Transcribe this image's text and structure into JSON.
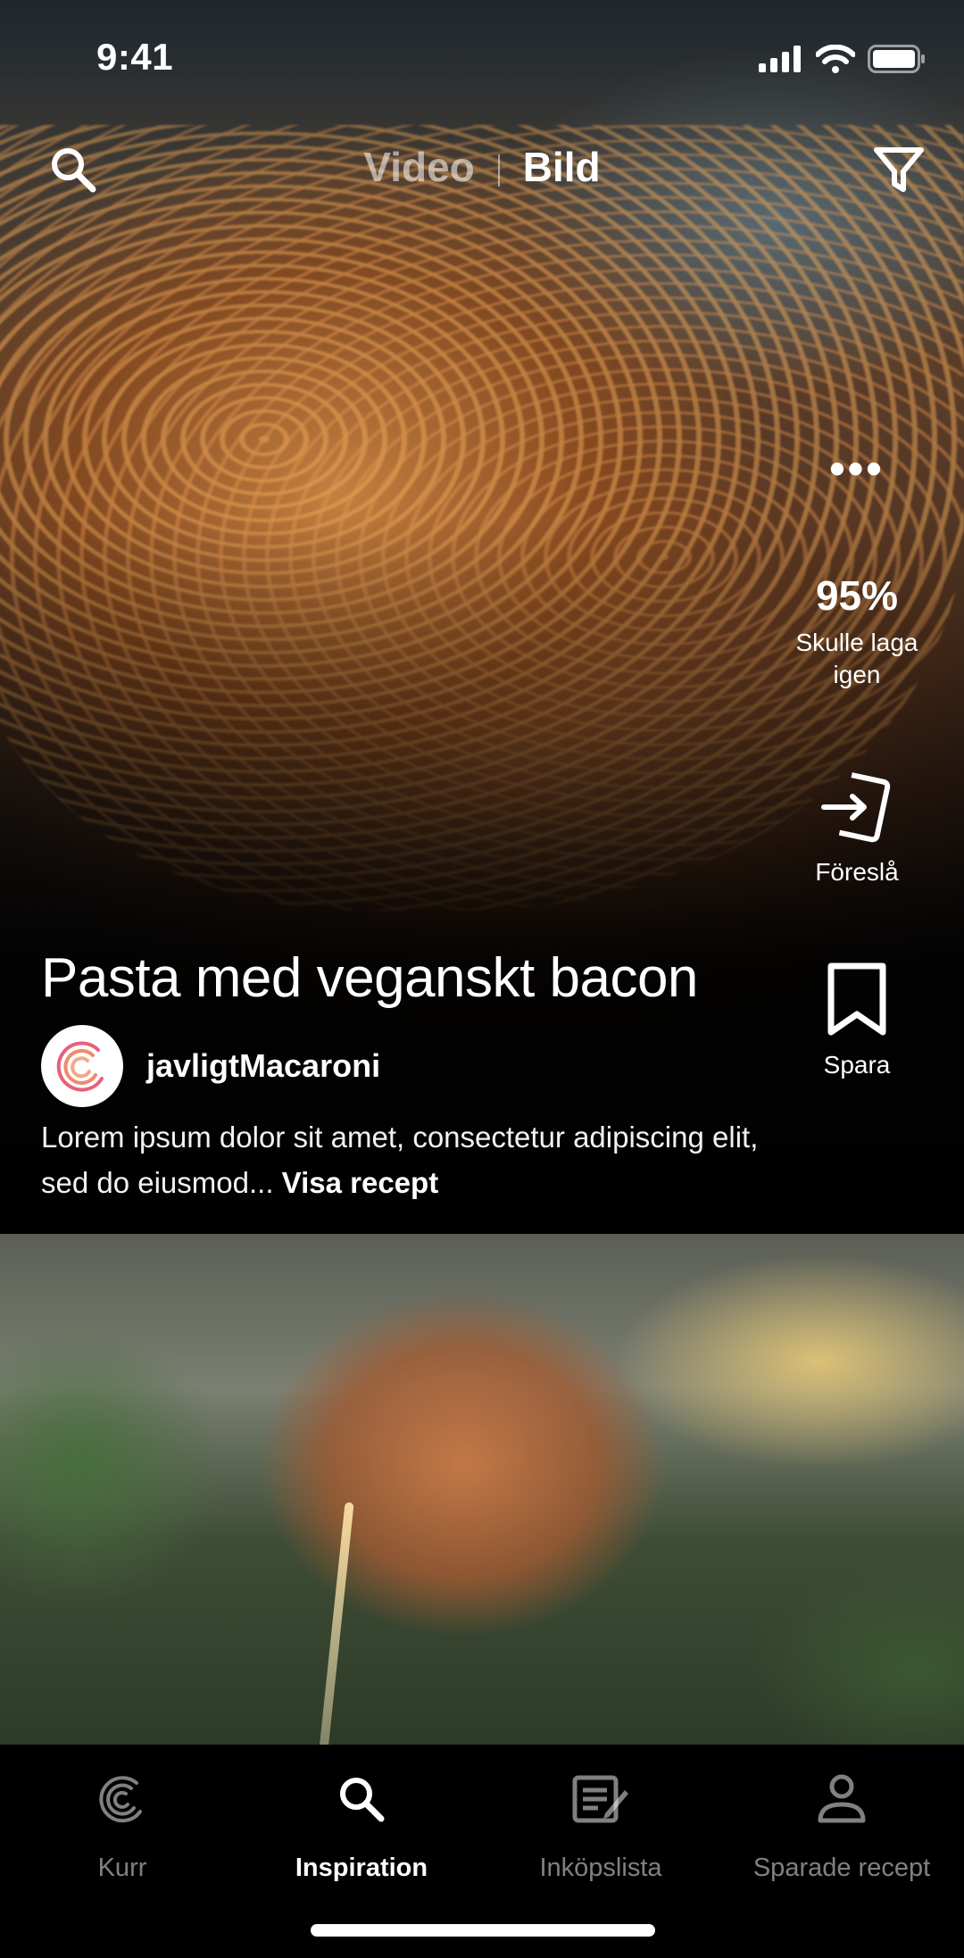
{
  "status_bar": {
    "time": "9:41"
  },
  "top_bar": {
    "mode_video": "Video",
    "mode_image": "Bild",
    "active_mode": "Bild"
  },
  "actions": {
    "more": "•••",
    "rating_value": "95%",
    "rating_label_line1": "Skulle laga",
    "rating_label_line2": "igen",
    "suggest_label": "Föreslå",
    "save_label": "Spara"
  },
  "recipe": {
    "title": "Pasta med veganskt bacon",
    "author": "javligtMacaroni",
    "description": "Lorem ipsum dolor sit amet, consectetur adipiscing elit, sed do eiusmod...",
    "show_recipe_link": "Visa recept"
  },
  "nav": {
    "items": [
      {
        "label": "Kurr",
        "icon": "kurr-logo-icon",
        "active": false
      },
      {
        "label": "Inspiration",
        "icon": "search-icon",
        "active": true
      },
      {
        "label": "Inköpslista",
        "icon": "shopping-list-icon",
        "active": false
      },
      {
        "label": "Sparade recept",
        "icon": "user-icon",
        "active": false
      }
    ]
  },
  "colors": {
    "background": "#000000",
    "text": "#ffffff",
    "inactive": "#808080",
    "avatar_accent": "#e8607a"
  }
}
